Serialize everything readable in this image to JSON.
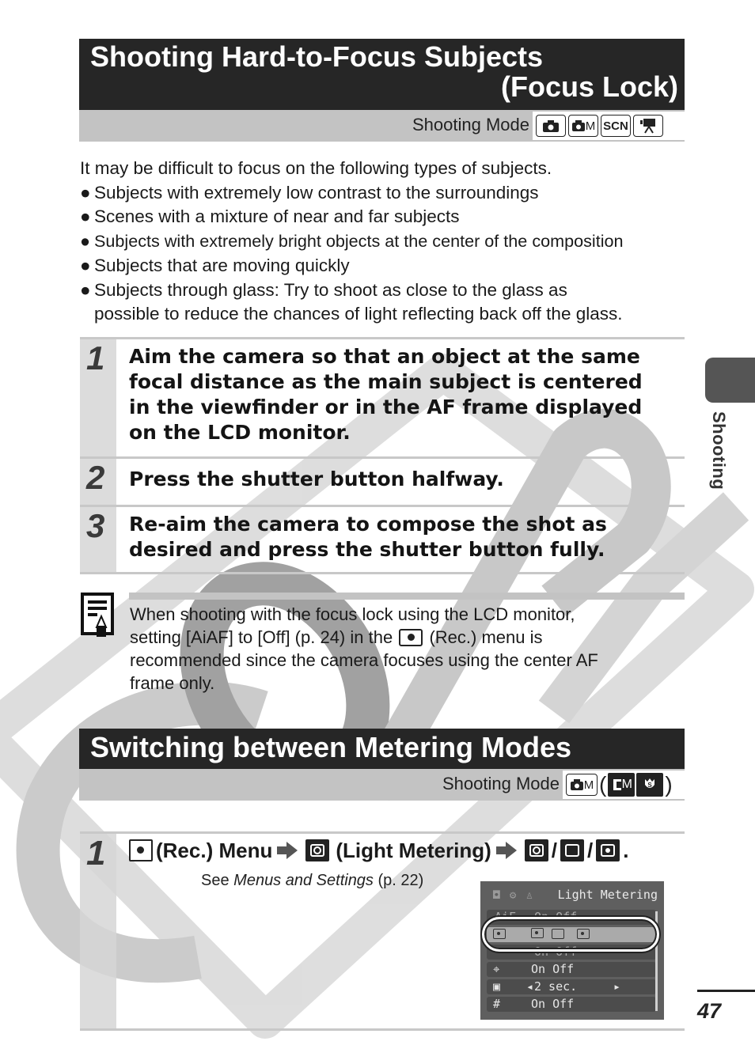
{
  "section1": {
    "title_line1": "Shooting Hard-to-Focus Subjects",
    "title_line2": "(Focus Lock)",
    "shooting_mode_label": "Shooting Mode",
    "mode_icons": [
      "auto-camera-icon",
      "manual-camera-icon",
      "SCN",
      "movie-icon"
    ],
    "mode_icon_text": {
      "manual": "M",
      "scn": "SCN"
    }
  },
  "intro": {
    "lead": "It may be difficult to focus on the following types of subjects.",
    "bullet_glyph": "●",
    "bullets": [
      "Subjects with extremely low contrast to the surroundings",
      "Scenes with a mixture of near and far subjects",
      "Subjects with extremely bright objects at the center of the composition",
      "Subjects that are moving quickly",
      "Subjects through glass: Try to shoot as close to the glass as"
    ],
    "bullet5_cont": "possible to reduce the chances of light reflecting back off the glass."
  },
  "steps": [
    {
      "num": "1",
      "text": "Aim the camera so that an object at the same focal distance as the main subject is centered in the viewfinder or in the AF frame displayed on the LCD monitor."
    },
    {
      "num": "2",
      "text": "Press the shutter button halfway."
    },
    {
      "num": "3",
      "text": "Re-aim the camera to compose the shot as desired and press the shutter button fully."
    }
  ],
  "note": {
    "line1": "When shooting with the focus lock using the LCD monitor,",
    "line2a": "setting [AiAF] to [Off] (p. 24) in the",
    "line2b": "(Rec.) menu is",
    "line3": "recommended since the camera focuses using the center AF",
    "line4": "frame only."
  },
  "section2": {
    "title": "Switching between Metering Modes",
    "shooting_mode_label": "Shooting Mode",
    "mode_icon_text": {
      "manual": "M",
      "open_paren": "(",
      "close_paren": ")",
      "custom": "M",
      "stitch": "S"
    }
  },
  "metering_step": {
    "num": "1",
    "rec_menu": "(Rec.) Menu",
    "light_metering": "(Light Metering)",
    "sep": "/",
    "end": ".",
    "see_prefix": "See ",
    "see_italic": "Menus and Settings",
    "see_suffix": " (p. 22)"
  },
  "lcd": {
    "title": "Light Metering",
    "tabs": "◘ ⚙ ♙",
    "rows": [
      {
        "icon": "AiF",
        "value": "On  Off"
      },
      {
        "icon": "metering",
        "value": ""
      },
      {
        "icon": "digital-zoom",
        "value": "On  Off"
      },
      {
        "icon": "af-assist",
        "value": "On  Off"
      },
      {
        "icon": "review",
        "value": "2 sec.",
        "left_arrow": "◂",
        "right_arrow": "▸"
      },
      {
        "icon": "grid",
        "icon_text": "#",
        "value": "On  Off"
      }
    ]
  },
  "side": {
    "tab_label": "Shooting",
    "page_number": "47"
  },
  "watermark": {
    "text": "COPY"
  }
}
